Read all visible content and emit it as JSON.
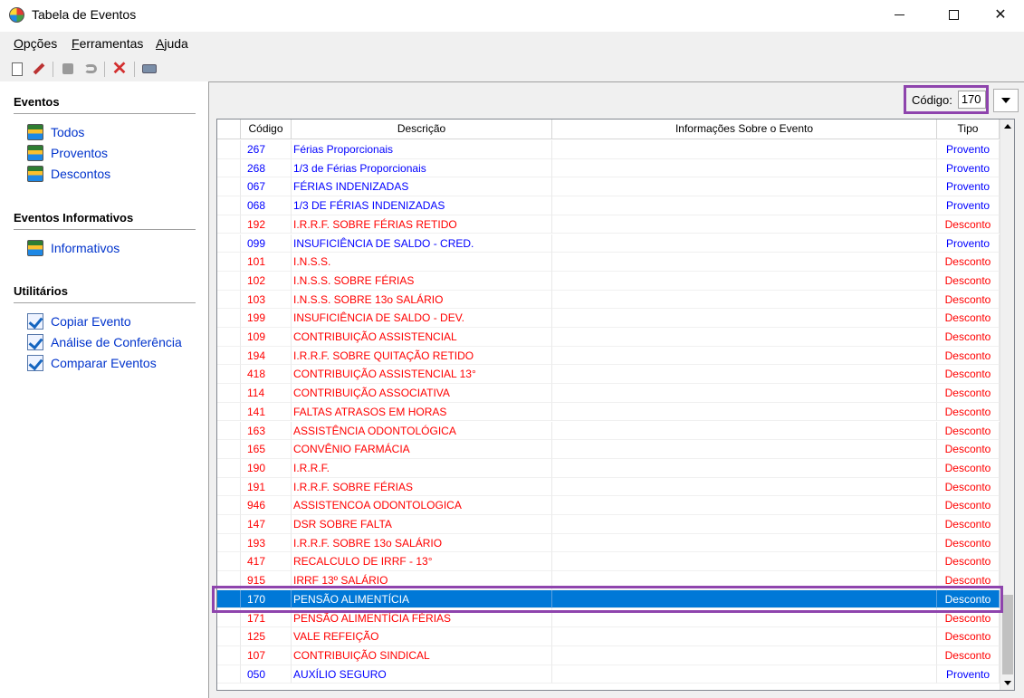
{
  "window": {
    "title": "Tabela de Eventos"
  },
  "menu": {
    "items": [
      {
        "u": "O",
        "rest": "pções"
      },
      {
        "u": "F",
        "rest": "erramentas"
      },
      {
        "u": "A",
        "rest": "juda"
      }
    ]
  },
  "toolbar": {
    "icons": [
      "new-icon",
      "edit-icon",
      "stop-icon",
      "undo-icon",
      "delete-icon",
      "print-icon"
    ]
  },
  "sidebar": {
    "eventos_title": "Eventos",
    "eventos_links": [
      "Todos",
      "Proventos",
      "Descontos"
    ],
    "informativos_title": "Eventos Informativos",
    "informativos_links": [
      "Informativos"
    ],
    "utilitarios_title": "Utilitários",
    "utilitarios_links": [
      "Copiar Evento",
      "Análise de Conferência",
      "Comparar Eventos"
    ]
  },
  "search": {
    "label": "Código:",
    "value": "170"
  },
  "table": {
    "headers": [
      "Código",
      "Descrição",
      "Informações Sobre o Evento",
      "Tipo"
    ],
    "selected_index": 24,
    "colors": {
      "Provento": "#0000ff",
      "Desconto": "#ff0000"
    },
    "rows": [
      {
        "codigo": "267",
        "descricao": "Férias Proporcionais",
        "info": "",
        "tipo": "Provento"
      },
      {
        "codigo": "268",
        "descricao": "1/3 de Férias Proporcionais",
        "info": "",
        "tipo": "Provento"
      },
      {
        "codigo": "067",
        "descricao": "FÉRIAS INDENIZADAS",
        "info": "",
        "tipo": "Provento"
      },
      {
        "codigo": "068",
        "descricao": "1/3 DE FÉRIAS INDENIZADAS",
        "info": "",
        "tipo": "Provento"
      },
      {
        "codigo": "192",
        "descricao": "I.R.R.F. SOBRE FÉRIAS RETIDO",
        "info": "",
        "tipo": "Desconto"
      },
      {
        "codigo": "099",
        "descricao": "INSUFICIÊNCIA DE SALDO - CRED.",
        "info": "",
        "tipo": "Provento"
      },
      {
        "codigo": "101",
        "descricao": "I.N.S.S.",
        "info": "",
        "tipo": "Desconto"
      },
      {
        "codigo": "102",
        "descricao": "I.N.S.S. SOBRE FÉRIAS",
        "info": "",
        "tipo": "Desconto"
      },
      {
        "codigo": "103",
        "descricao": "I.N.S.S. SOBRE 13o SALÁRIO",
        "info": "",
        "tipo": "Desconto"
      },
      {
        "codigo": "199",
        "descricao": "INSUFICIÊNCIA DE SALDO - DEV.",
        "info": "",
        "tipo": "Desconto"
      },
      {
        "codigo": "109",
        "descricao": "CONTRIBUIÇÃO ASSISTENCIAL",
        "info": "",
        "tipo": "Desconto"
      },
      {
        "codigo": "194",
        "descricao": "I.R.R.F. SOBRE QUITAÇÃO RETIDO",
        "info": "",
        "tipo": "Desconto"
      },
      {
        "codigo": "418",
        "descricao": "CONTRIBUIÇÃO ASSISTENCIAL 13°",
        "info": "",
        "tipo": "Desconto"
      },
      {
        "codigo": "114",
        "descricao": "CONTRIBUIÇÃO ASSOCIATIVA",
        "info": "",
        "tipo": "Desconto"
      },
      {
        "codigo": "141",
        "descricao": "FALTAS ATRASOS EM HORAS",
        "info": "",
        "tipo": "Desconto"
      },
      {
        "codigo": "163",
        "descricao": "ASSISTÊNCIA ODONTOLÓGICA",
        "info": "",
        "tipo": "Desconto"
      },
      {
        "codigo": "165",
        "descricao": "CONVÊNIO FARMÁCIA",
        "info": "",
        "tipo": "Desconto"
      },
      {
        "codigo": "190",
        "descricao": "I.R.R.F.",
        "info": "",
        "tipo": "Desconto"
      },
      {
        "codigo": "191",
        "descricao": "I.R.R.F. SOBRE FÉRIAS",
        "info": "",
        "tipo": "Desconto"
      },
      {
        "codigo": "946",
        "descricao": "ASSISTENCOA ODONTOLOGICA",
        "info": "",
        "tipo": "Desconto"
      },
      {
        "codigo": "147",
        "descricao": "DSR SOBRE FALTA",
        "info": "",
        "tipo": "Desconto"
      },
      {
        "codigo": "193",
        "descricao": "I.R.R.F. SOBRE 13o SALÁRIO",
        "info": "",
        "tipo": "Desconto"
      },
      {
        "codigo": "417",
        "descricao": "RECALCULO DE IRRF - 13°",
        "info": "",
        "tipo": "Desconto"
      },
      {
        "codigo": "915",
        "descricao": "IRRF 13º SALÁRIO",
        "info": "",
        "tipo": "Desconto"
      },
      {
        "codigo": "170",
        "descricao": "PENSÃO ALIMENTÍCIA",
        "info": "",
        "tipo": "Desconto"
      },
      {
        "codigo": "171",
        "descricao": "PENSÃO ALIMENTÍCIA FÉRIAS",
        "info": "",
        "tipo": "Desconto"
      },
      {
        "codigo": "125",
        "descricao": "VALE REFEIÇÃO",
        "info": "",
        "tipo": "Desconto"
      },
      {
        "codigo": "107",
        "descricao": "CONTRIBUIÇÃO SINDICAL",
        "info": "",
        "tipo": "Desconto"
      },
      {
        "codigo": "050",
        "descricao": "AUXÍLIO SEGURO",
        "info": "",
        "tipo": "Provento"
      }
    ]
  }
}
